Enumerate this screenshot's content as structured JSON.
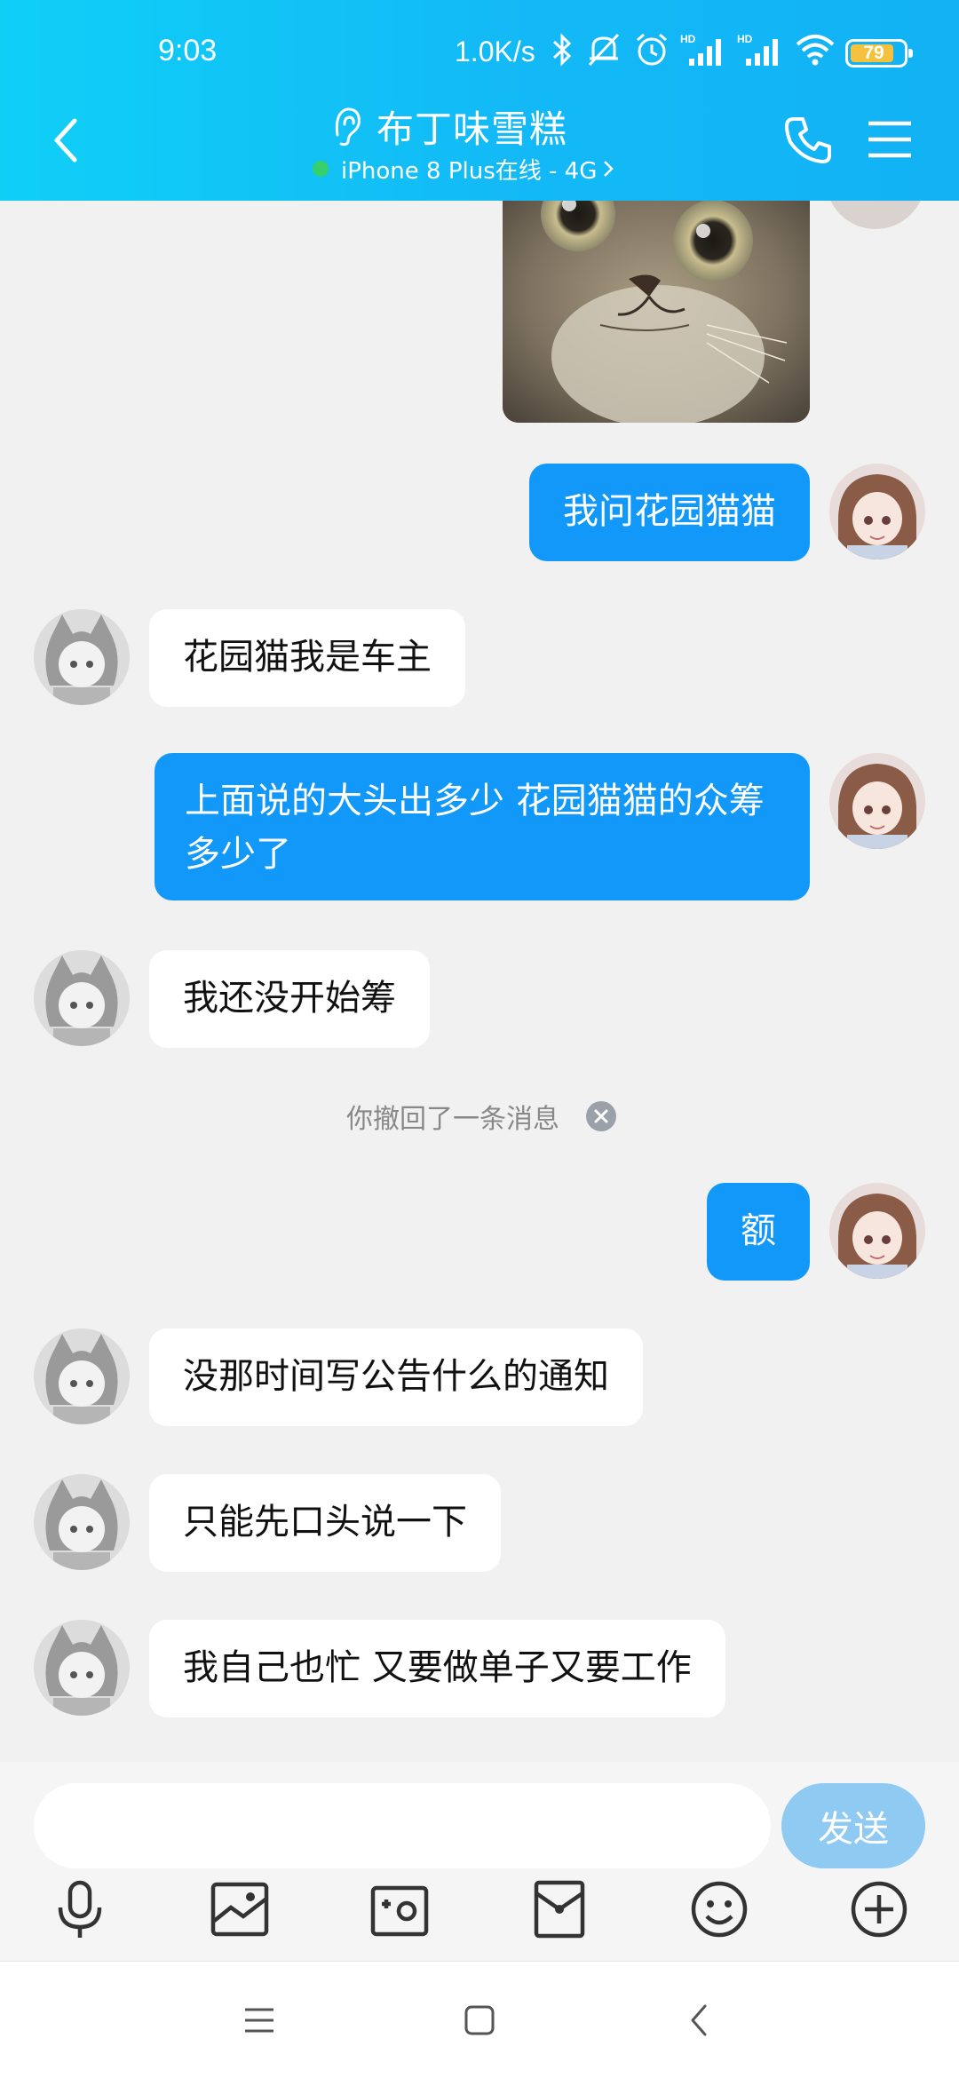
{
  "status_bar": {
    "time": "9:03",
    "net_speed": "1.0K/s",
    "battery": "79"
  },
  "header": {
    "title": "布丁味雪糕",
    "subtitle": "iPhone 8 Plus在线 - 4G",
    "online_color": "#35d06b",
    "icons": [
      "back-icon",
      "ear-icon",
      "phone-icon",
      "menu-icon"
    ]
  },
  "messages": [
    {
      "side": "out",
      "type": "image",
      "desc": "cat-sticker"
    },
    {
      "side": "out",
      "text": "我问花园猫猫"
    },
    {
      "side": "in",
      "text": "花园猫我是车主"
    },
    {
      "side": "out",
      "text": "上面说的大头出多少 花园猫猫的众筹多少了"
    },
    {
      "side": "in",
      "text": "我还没开始筹"
    },
    {
      "side": "system",
      "text": "你撤回了一条消息"
    },
    {
      "side": "out",
      "text": "额"
    },
    {
      "side": "in",
      "text": "没那时间写公告什么的通知"
    },
    {
      "side": "in",
      "text": "只能先口头说一下"
    },
    {
      "side": "in",
      "text": "我自己也忙 又要做单子又要工作"
    }
  ],
  "input": {
    "value": "",
    "placeholder": "",
    "send_label": "发送"
  },
  "toolbar": [
    "mic-icon",
    "image-icon",
    "camera-icon",
    "red-packet-icon",
    "emoji-icon",
    "plus-icon"
  ],
  "colors": {
    "header": "#13b9f6",
    "bubble_out": "#1198f8",
    "bubble_in": "#ffffff",
    "send_button": "#8fcaf2"
  }
}
